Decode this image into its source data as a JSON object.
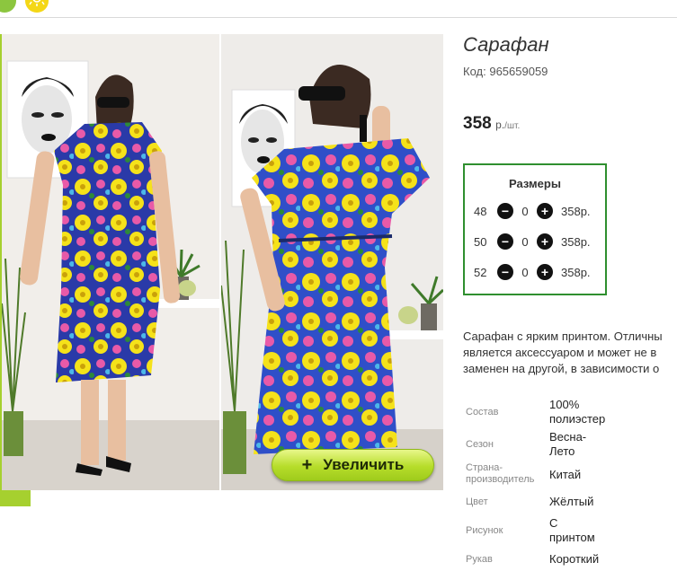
{
  "header": {
    "icons": [
      "green-circle-icon",
      "sun-icon"
    ]
  },
  "product": {
    "title": "Сарафан",
    "code_label": "Код:",
    "code_value": "965659059",
    "price_value": "358",
    "price_currency": "р.",
    "price_per": "/шт.",
    "description_lines": [
      "Сарафан с ярким принтом. Отличны",
      "является аксессуаром и может не в",
      "заменен на другой, в зависимости о"
    ]
  },
  "gallery": {
    "zoom_plus": "+",
    "zoom_label": "Увеличить"
  },
  "sizes": {
    "title": "Размеры",
    "minus": "−",
    "plus": "+",
    "rows": [
      {
        "size": "48",
        "qty": "0",
        "price": "358р."
      },
      {
        "size": "50",
        "qty": "0",
        "price": "358р."
      },
      {
        "size": "52",
        "qty": "0",
        "price": "358р."
      }
    ]
  },
  "properties": [
    {
      "label": [
        "Состав"
      ],
      "value": [
        "100%",
        "полиэстер"
      ]
    },
    {
      "label": [
        "Сезон"
      ],
      "value": [
        "Весна-",
        "Лето"
      ]
    },
    {
      "label": [
        "Страна-",
        "производитель"
      ],
      "value": [
        "Китай"
      ]
    },
    {
      "label": [
        "Цвет"
      ],
      "value": [
        "Жёлтый"
      ]
    },
    {
      "label": [
        "Рисунок"
      ],
      "value": [
        "С",
        "принтом"
      ]
    },
    {
      "label": [
        "Рукав"
      ],
      "value": [
        "Короткий"
      ]
    }
  ],
  "colors": {
    "accent_green": "#a6d02f",
    "sizes_border": "#2f8f2f",
    "zoom_button": "#b6dd2a",
    "dress_yellow": "#f5e21a",
    "dress_pink": "#e85aa8",
    "dress_blue": "#2f4fc8"
  }
}
